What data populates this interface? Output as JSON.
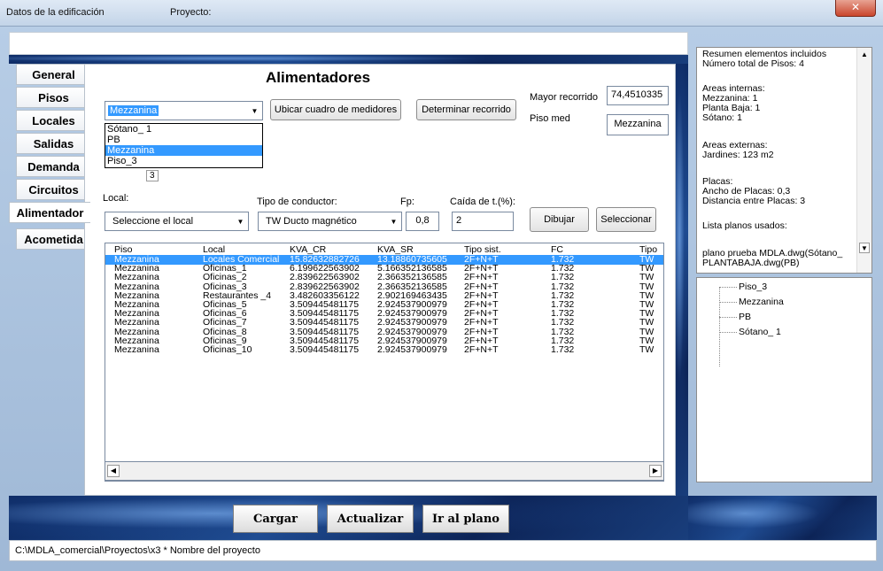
{
  "window": {
    "title": "Datos de la edificación",
    "subtitle": "Proyecto:",
    "close_icon": "close-icon"
  },
  "tabs": [
    "General",
    "Pisos",
    "Locales",
    "Salidas",
    "Demanda",
    "Circuitos",
    "Alimentador",
    "Acometida"
  ],
  "active_tab": "Alimentador",
  "main": {
    "heading": "Alimentadores",
    "floor_combo": {
      "value": "Mezzanina",
      "options": [
        "Sótano_ 1",
        "PB",
        "Mezzanina",
        "Piso_3"
      ]
    },
    "btn_ubicar": "Ubicar cuadro de medidores",
    "btn_determinar": "Determinar recorrido",
    "mayor_recorrido_label": "Mayor recorrido",
    "mayor_recorrido_value": "74,4510335",
    "piso_med_label": "Piso med",
    "piso_med_value": "Mezzanina",
    "local_label": "Local:",
    "local_value": "Seleccione el local",
    "tipo_conductor_label": "Tipo de conductor:",
    "tipo_conductor_value": "TW Ducto magnético",
    "fp_label": "Fp:",
    "fp_value": "0,8",
    "caida_label": "Caída de t.(%):",
    "caida_value": "2",
    "btn_dibujar": "Dibujar",
    "btn_seleccionar": "Seleccionar",
    "partial_text": "3"
  },
  "table": {
    "columns": [
      "Piso",
      "Local",
      "KVA_CR",
      "KVA_SR",
      "Tipo sist.",
      "FC",
      "Tipo"
    ],
    "rows": [
      [
        "Mezzanina",
        "Locales Comercial",
        "15.82632882726",
        "13.18860735605",
        "2F+N+T",
        "1.732",
        "TW"
      ],
      [
        "Mezzanina",
        "Oficinas_1",
        "6.199622563902",
        "5.166352136585",
        "2F+N+T",
        "1.732",
        "TW"
      ],
      [
        "Mezzanina",
        "Oficinas_2",
        "2.839622563902",
        "2.366352136585",
        "2F+N+T",
        "1.732",
        "TW"
      ],
      [
        "Mezzanina",
        "Oficinas_3",
        "2.839622563902",
        "2.366352136585",
        "2F+N+T",
        "1.732",
        "TW"
      ],
      [
        "Mezzanina",
        "Restaurantes _4",
        "3.482603356122",
        "2.902169463435",
        "2F+N+T",
        "1.732",
        "TW"
      ],
      [
        "Mezzanina",
        "Oficinas_5",
        "3.509445481175",
        "2.924537900979",
        "2F+N+T",
        "1.732",
        "TW"
      ],
      [
        "Mezzanina",
        "Oficinas_6",
        "3.509445481175",
        "2.924537900979",
        "2F+N+T",
        "1.732",
        "TW"
      ],
      [
        "Mezzanina",
        "Oficinas_7",
        "3.509445481175",
        "2.924537900979",
        "2F+N+T",
        "1.732",
        "TW"
      ],
      [
        "Mezzanina",
        "Oficinas_8",
        "3.509445481175",
        "2.924537900979",
        "2F+N+T",
        "1.732",
        "TW"
      ],
      [
        "Mezzanina",
        "Oficinas_9",
        "3.509445481175",
        "2.924537900979",
        "2F+N+T",
        "1.732",
        "TW"
      ],
      [
        "Mezzanina",
        "Oficinas_10",
        "3.509445481175",
        "2.924537900979",
        "2F+N+T",
        "1.732",
        "TW"
      ]
    ],
    "selected_row": 0
  },
  "bottom": {
    "cargar": "Cargar",
    "actualizar": "Actualizar",
    "ir_plano": "Ir al plano"
  },
  "status": "C:\\MDLA_comercial\\Proyectos\\x3 * Nombre del proyecto",
  "summary": {
    "lines": [
      "Resumen elementos incluidos",
      "Número total de Pisos:  4",
      "",
      "Areas internas:",
      "Mezzanina:  1",
      "Planta Baja:  1",
      "Sótano:  1",
      "",
      "Areas externas:",
      "Jardines: 123 m2",
      "",
      "Placas:",
      "Ancho de Placas: 0,3",
      "Distancia entre Placas: 3",
      "",
      "Lista planos usados:",
      "",
      "plano prueba MDLA.dwg(Sótano_",
      "PLANTABAJA.dwg(PB)"
    ]
  },
  "tree": [
    "Piso_3",
    "Mezzanina",
    "PB",
    "Sótano_ 1"
  ],
  "colors": {
    "selection": "#3399ff",
    "window_bg": "#b7cde6",
    "deco_blue": "#1f4c92"
  }
}
